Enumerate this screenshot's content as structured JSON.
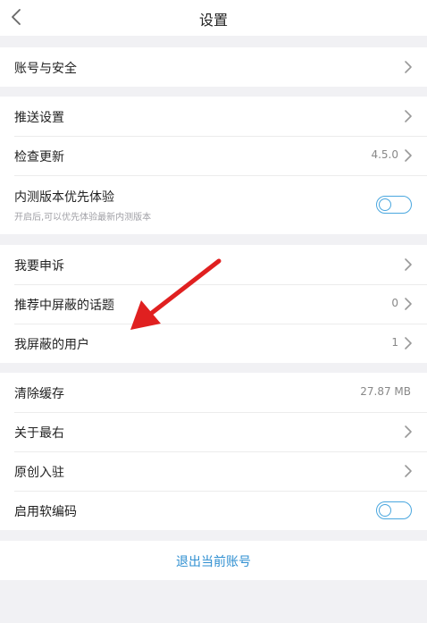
{
  "header": {
    "title": "设置",
    "back_icon": "chevron-left-icon"
  },
  "account_section": {
    "items": [
      {
        "label": "账号与安全"
      }
    ]
  },
  "push_section": {
    "push_label": "推送设置",
    "update_label": "检查更新",
    "update_value": "4.5.0",
    "beta_label": "内测版本优先体验",
    "beta_desc": "开启后,可以优先体验最新内测版本",
    "beta_enabled": false
  },
  "privacy_section": {
    "appeal_label": "我要申诉",
    "topics_label": "推荐中屏蔽的话题",
    "topics_count": "0",
    "users_label": "我屏蔽的用户",
    "users_count": "1"
  },
  "misc_section": {
    "cache_label": "清除缓存",
    "cache_value": "27.87 MB",
    "about_label": "关于最右",
    "original_label": "原创入驻",
    "softcode_label": "启用软编码",
    "softcode_enabled": false
  },
  "logout": {
    "label": "退出当前账号"
  },
  "colors": {
    "accent": "#4aa7df",
    "link": "#2f8fd1",
    "annotation_arrow": "#e02020",
    "background": "#f1f1f4"
  },
  "annotation": {
    "icon": "red-arrow-icon",
    "points_to": "我屏蔽的用户"
  }
}
